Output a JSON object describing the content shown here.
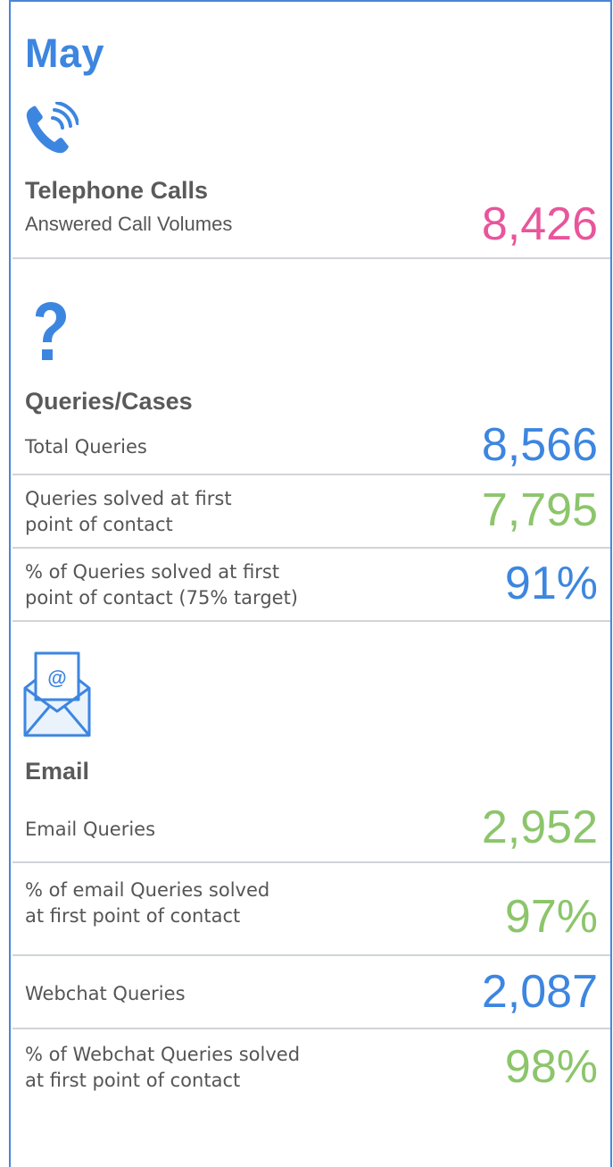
{
  "month": "May",
  "colors": {
    "accent_blue": "#3d86e0",
    "pink": "#e8559b",
    "green": "#8cc56b",
    "divider": "#d0d4d8"
  },
  "telephone": {
    "icon": "phone-icon",
    "title": "Telephone Calls",
    "rows": [
      {
        "label": "Answered Call Volumes",
        "value": "8,426",
        "color": "pink"
      }
    ]
  },
  "queries": {
    "icon": "question-mark-icon",
    "title": "Queries/Cases",
    "rows": [
      {
        "label": "Total Queries",
        "value": "8,566",
        "color": "blue"
      },
      {
        "label_line1": "Queries solved at first",
        "label_line2": "point of contact",
        "value": "7,795",
        "color": "green"
      },
      {
        "label_line1": "% of Queries solved at first",
        "label_line2": "point of contact (75% target)",
        "value": "91%",
        "color": "blue"
      }
    ]
  },
  "email": {
    "icon": "envelope-at-icon",
    "title": "Email",
    "rows": [
      {
        "label": "Email Queries",
        "value": "2,952",
        "color": "green"
      },
      {
        "label_line1": "% of email Queries solved",
        "label_line2": "at first point of contact",
        "value": "97%",
        "color": "green"
      },
      {
        "label": "Webchat Queries",
        "value": "2,087",
        "color": "blue"
      },
      {
        "label_line1": "% of Webchat Queries solved",
        "label_line2": "at first point of contact",
        "value": "98%",
        "color": "green"
      }
    ]
  }
}
